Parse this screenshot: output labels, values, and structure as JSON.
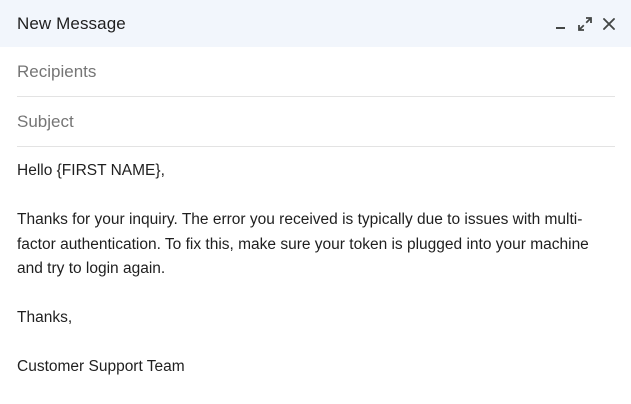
{
  "window": {
    "title": "New Message"
  },
  "controls": {
    "minimize_icon": "minimize-icon",
    "expand_icon": "expand-icon",
    "close_icon": "close-icon"
  },
  "fields": {
    "recipients_placeholder": "Recipients",
    "subject_placeholder": "Subject"
  },
  "message": {
    "greeting": "Hello {FIRST NAME},",
    "paragraph": "Thanks for your inquiry. The error you received is typically due to issues with multi-factor authentication. To fix this, make sure your token is plugged into your machine and try to login again.",
    "closing": "Thanks,",
    "signature": "Customer Support Team"
  }
}
